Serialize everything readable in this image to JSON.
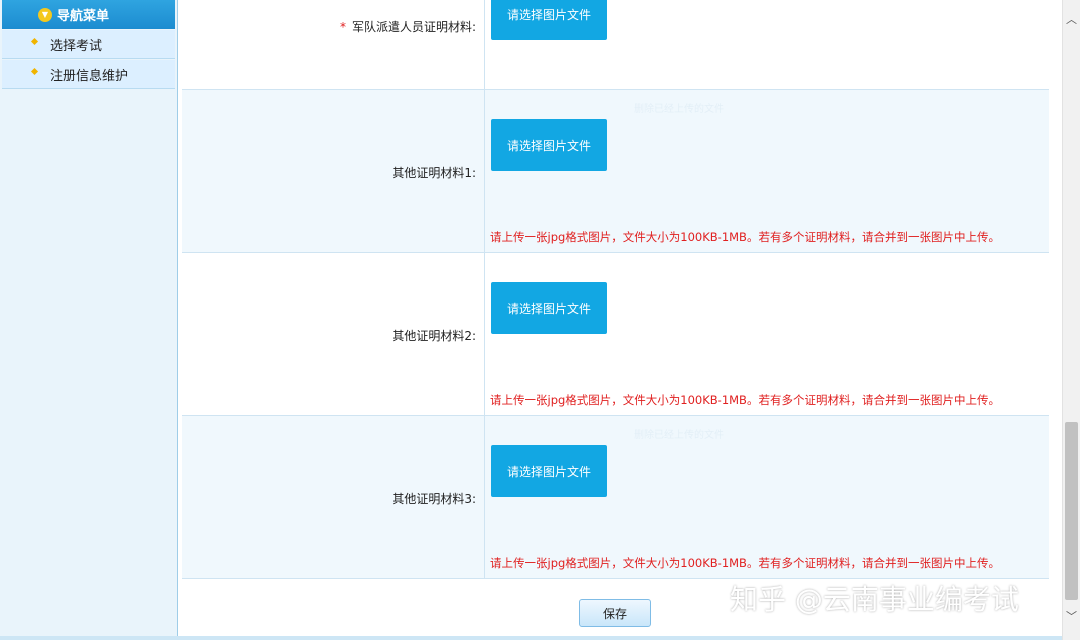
{
  "sidebar": {
    "header": "导航菜单",
    "items": [
      {
        "label": "选择考试"
      },
      {
        "label": "注册信息维护"
      }
    ]
  },
  "form": {
    "rows": [
      {
        "label": "军队派遣人员证明材料:",
        "required": true,
        "button": "请选择图片文件"
      },
      {
        "label": "其他证明材料1:",
        "button": "请选择图片文件",
        "faint": "删除已经上传的文件",
        "hint": "请上传一张jpg格式图片，文件大小为100KB-1MB。若有多个证明材料，请合并到一张图片中上传。"
      },
      {
        "label": "其他证明材料2:",
        "button": "请选择图片文件",
        "hint": "请上传一张jpg格式图片，文件大小为100KB-1MB。若有多个证明材料，请合并到一张图片中上传。"
      },
      {
        "label": "其他证明材料3:",
        "button": "请选择图片文件",
        "faint": "删除已经上传的文件",
        "hint": "请上传一张jpg格式图片，文件大小为100KB-1MB。若有多个证明材料，请合并到一张图片中上传。"
      }
    ],
    "required_mark": "*",
    "save_label": "保存"
  },
  "watermark": "知乎 @云南事业编考试",
  "colors": {
    "accent": "#12a7e3",
    "hint_red": "#e02020",
    "sidebar_bg": "#e9f4fb"
  },
  "icons": {
    "nav_header": "chevron-down-circle-icon",
    "nav_item": "diamond-bullet-icon",
    "scroll_up": "chevron-up-icon",
    "scroll_down": "chevron-down-icon"
  }
}
